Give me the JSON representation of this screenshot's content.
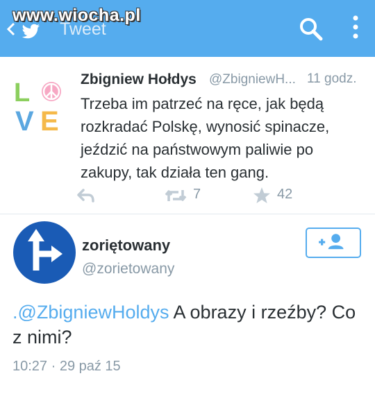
{
  "watermark": "www.wiocha.pl",
  "header": {
    "title": "Tweet",
    "back_icon": "chevron-left-icon",
    "bird_icon": "twitter-bird-icon",
    "search_icon": "search-icon",
    "more_icon": "more-vertical-icon",
    "color": "#55acee"
  },
  "tweet": {
    "avatar_icon": "love-peace-icon",
    "author_name": "Zbigniew Hołdys",
    "author_handle": "@ZbigniewH...",
    "time": "11 godz.",
    "text": "Trzeba im patrzeć na ręce, jak będą rozkradać Polskę, wynosić spinacze, jeździć na państwowym paliwie po zakupy, tak działa ten gang.",
    "retweets": "7",
    "favorites": "42"
  },
  "reply": {
    "avatar_icon": "direction-arrow-icon",
    "author_name": "zoriętowany",
    "author_handle": "@zorietowany",
    "follow_icon": "follow-user-icon",
    "mention": ".@ZbigniewHoldys",
    "text": " A obrazy i rzeźby? Co z nimi?",
    "meta": "10:27 · 29 paź 15"
  }
}
